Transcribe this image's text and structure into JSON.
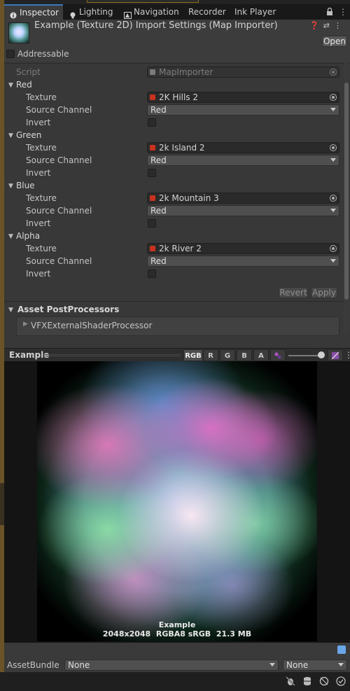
{
  "tabs": [
    {
      "label": "Inspector",
      "icon": "info-icon",
      "active": true
    },
    {
      "label": "Lighting",
      "icon": "lightbulb-icon",
      "active": false
    },
    {
      "label": "Navigation",
      "icon": "navigation-icon",
      "active": false
    },
    {
      "label": "Recorder",
      "icon": "",
      "active": false
    },
    {
      "label": "Ink Player",
      "icon": "",
      "active": false
    }
  ],
  "header": {
    "title": "Example (Texture 2D) Import Settings (Map Importer)",
    "open_label": "Open",
    "addressable_label": "Addressable"
  },
  "script": {
    "label": "Script",
    "value": "MapImporter"
  },
  "channels": [
    {
      "name": "Red",
      "texture": "2K Hills 2",
      "source_channel": "Red",
      "invert": false
    },
    {
      "name": "Green",
      "texture": "2k Island 2",
      "source_channel": "Red",
      "invert": false
    },
    {
      "name": "Blue",
      "texture": "2k Mountain 3",
      "source_channel": "Red",
      "invert": false
    },
    {
      "name": "Alpha",
      "texture": "2k River 2",
      "source_channel": "Red",
      "invert": false
    }
  ],
  "field_labels": {
    "texture": "Texture",
    "source_channel": "Source Channel",
    "invert": "Invert"
  },
  "buttons": {
    "revert": "Revert",
    "apply": "Apply"
  },
  "postprocessors": {
    "title": "Asset PostProcessors",
    "item": "VFXExternalShaderProcessor"
  },
  "preview": {
    "title": "Example",
    "channels": [
      "RGB",
      "R",
      "G",
      "B",
      "A"
    ],
    "caption_name": "Example",
    "caption_info": "2048x2048  RGBA8 sRGB  21.3 MB"
  },
  "assetbundle": {
    "label": "AssetBundle",
    "name": "None",
    "variant": "None"
  },
  "colors": {
    "accent": "#3a79bb",
    "panel": "#383838",
    "texture_icon": "#c8321f"
  }
}
